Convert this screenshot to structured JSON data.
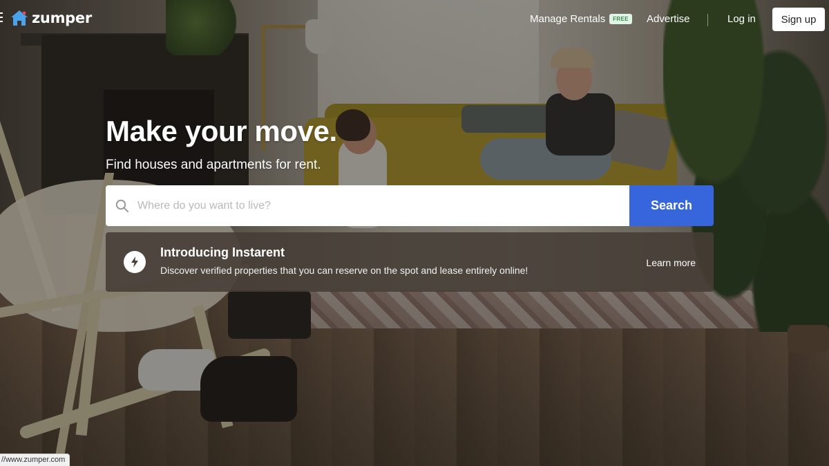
{
  "header": {
    "logo_text": "zumper",
    "nav": {
      "manage_rentals": "Manage Rentals",
      "free_badge": "FREE",
      "advertise": "Advertise",
      "login": "Log in",
      "signup": "Sign up"
    }
  },
  "hero": {
    "title": "Make your move.",
    "subtitle": "Find houses and apartments for rent."
  },
  "search": {
    "placeholder": "Where do you want to live?",
    "value": "",
    "button_label": "Search",
    "icon": "search-icon"
  },
  "promo": {
    "icon": "lightning-bolt-icon",
    "title": "Introducing Instarent",
    "description": "Discover verified properties that you can reserve on the spot and lease entirely online!",
    "link_label": "Learn more"
  },
  "status_bar": {
    "url": "//www.zumper.com"
  },
  "colors": {
    "accent": "#3766dc",
    "logo_house": "#4aa3e8",
    "logo_accent": "#e8465a",
    "badge_bg": "#dff4e4",
    "badge_text": "#3b8a4e"
  }
}
